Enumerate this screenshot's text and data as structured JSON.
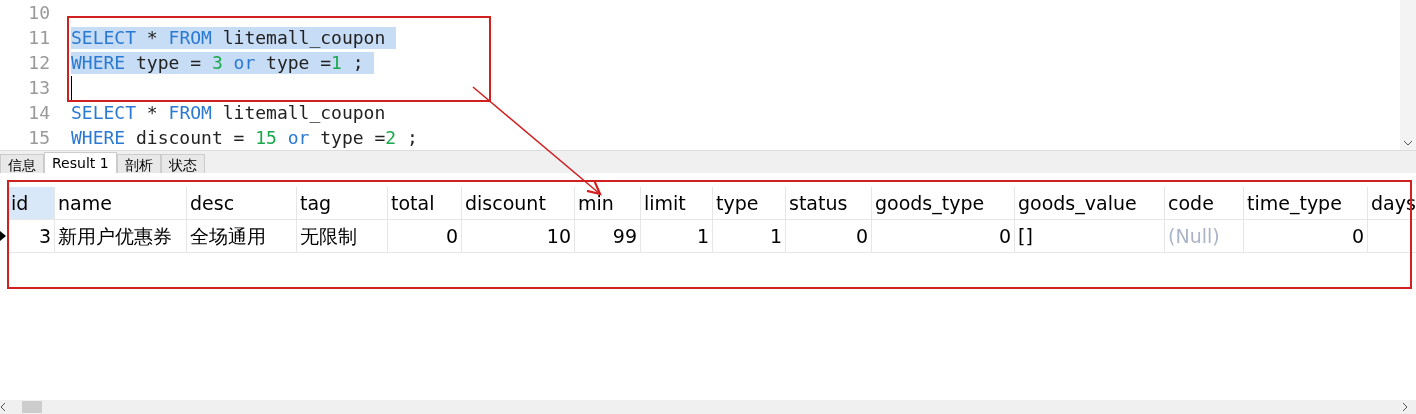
{
  "editor": {
    "lines": [
      {
        "number": "10",
        "selected": false,
        "cursor": false
      },
      {
        "number": "11",
        "selected": true,
        "cursor": false,
        "tokens": [
          {
            "text": "SELECT",
            "kind": "keyword"
          },
          {
            "text": " * ",
            "kind": "plain"
          },
          {
            "text": "FROM",
            "kind": "keyword"
          },
          {
            "text": " litemall_coupon ",
            "kind": "plain"
          }
        ]
      },
      {
        "number": "12",
        "selected": true,
        "cursor": false,
        "tokens": [
          {
            "text": "WHERE",
            "kind": "keyword"
          },
          {
            "text": " type = ",
            "kind": "plain"
          },
          {
            "text": "3",
            "kind": "number"
          },
          {
            "text": " or",
            "kind": "keyword"
          },
          {
            "text": " type =",
            "kind": "plain"
          },
          {
            "text": "1",
            "kind": "number"
          },
          {
            "text": " ; ",
            "kind": "plain"
          }
        ]
      },
      {
        "number": "13",
        "selected": false,
        "cursor": true
      },
      {
        "number": "14",
        "selected": false,
        "cursor": false,
        "tokens": [
          {
            "text": "SELECT",
            "kind": "keyword"
          },
          {
            "text": " * ",
            "kind": "plain"
          },
          {
            "text": "FROM",
            "kind": "keyword"
          },
          {
            "text": " litemall_coupon",
            "kind": "plain"
          }
        ]
      },
      {
        "number": "15",
        "selected": false,
        "cursor": false,
        "tokens": [
          {
            "text": "WHERE",
            "kind": "keyword"
          },
          {
            "text": " discount = ",
            "kind": "plain"
          },
          {
            "text": "15",
            "kind": "number"
          },
          {
            "text": " or",
            "kind": "keyword"
          },
          {
            "text": " type =",
            "kind": "plain"
          },
          {
            "text": "2",
            "kind": "number"
          },
          {
            "text": " ;",
            "kind": "plain"
          }
        ]
      }
    ]
  },
  "tabs": [
    {
      "label": "信息",
      "selected": false
    },
    {
      "label": "Result 1",
      "selected": true
    },
    {
      "label": "剖析",
      "selected": false
    },
    {
      "label": "状态",
      "selected": false
    }
  ],
  "grid": {
    "columns": [
      {
        "label": "id",
        "selected": true
      },
      {
        "label": "name",
        "selected": false
      },
      {
        "label": "desc",
        "selected": false
      },
      {
        "label": "tag",
        "selected": false
      },
      {
        "label": "total",
        "selected": false
      },
      {
        "label": "discount",
        "selected": false
      },
      {
        "label": "min",
        "selected": false
      },
      {
        "label": "limit",
        "selected": false
      },
      {
        "label": "type",
        "selected": false
      },
      {
        "label": "status",
        "selected": false
      },
      {
        "label": "goods_type",
        "selected": false
      },
      {
        "label": "goods_value",
        "selected": false
      },
      {
        "label": "code",
        "selected": false
      },
      {
        "label": "time_type",
        "selected": false
      },
      {
        "label": "days",
        "selected": false
      }
    ],
    "rows": [
      {
        "current": true,
        "cells": [
          {
            "text": "3",
            "kind": "number"
          },
          {
            "text": "新用户优惠券",
            "kind": "text"
          },
          {
            "text": "全场通用",
            "kind": "text"
          },
          {
            "text": "无限制",
            "kind": "text"
          },
          {
            "text": "0",
            "kind": "number"
          },
          {
            "text": "10",
            "kind": "number"
          },
          {
            "text": "99",
            "kind": "number"
          },
          {
            "text": "1",
            "kind": "number"
          },
          {
            "text": "1",
            "kind": "number"
          },
          {
            "text": "0",
            "kind": "number"
          },
          {
            "text": "0",
            "kind": "number"
          },
          {
            "text": "[]",
            "kind": "text"
          },
          {
            "text": "(Null)",
            "kind": "null"
          },
          {
            "text": "0",
            "kind": "number"
          }
        ]
      }
    ]
  }
}
